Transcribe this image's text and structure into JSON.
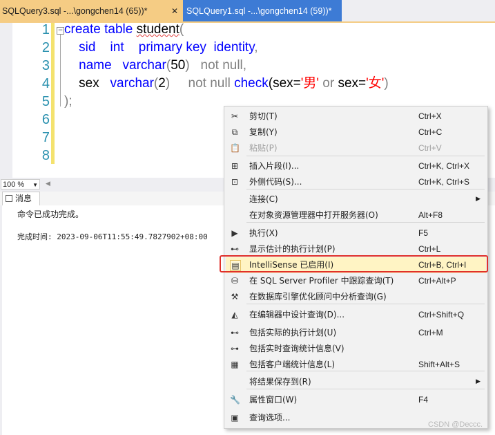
{
  "tabs": [
    {
      "label": "SQLQuery3.sql -...\\gongchen14 (65))*",
      "close": "✕"
    },
    {
      "label": "SQLQuery1.sql -...\\gongchen14 (59))*"
    }
  ],
  "editor": {
    "line_numbers": [
      "1",
      "2",
      "3",
      "4",
      "5",
      "6",
      "7",
      "8"
    ],
    "code": {
      "l1": {
        "create": "create",
        "table": "table",
        "name": "student",
        "paren": "("
      },
      "l2": {
        "col": "sid",
        "type": "int",
        "pk": "primary key",
        "identity": "identity",
        "comma": ","
      },
      "l3": {
        "col": "name",
        "type": "varchar",
        "open": "(",
        "len": "50",
        "close": ")",
        "notnull": "not null",
        "comma": ","
      },
      "l4": {
        "col": "sex",
        "type": "varchar",
        "open": "(",
        "len": "2",
        "close": ")",
        "notnull": "not null",
        "check": "check",
        "expr_open": "(sex=",
        "v1": "'男'",
        "or": " or ",
        "sex2": "sex=",
        "v2": "'女'",
        "expr_close": ")"
      },
      "l5": {
        "text": ");"
      }
    }
  },
  "zoom": {
    "value": "100 %"
  },
  "messages": {
    "tab_label": "消息",
    "line1": "命令已成功完成。",
    "line2": "完成时间: 2023-09-06T11:55:49.7827902+08:00"
  },
  "context_menu": {
    "items": [
      {
        "icon": "cut-icon",
        "glyph": "✂",
        "label": "剪切(T)",
        "shortcut": "Ctrl+X"
      },
      {
        "icon": "copy-icon",
        "glyph": "⧉",
        "label": "复制(Y)",
        "shortcut": "Ctrl+C"
      },
      {
        "icon": "paste-icon",
        "glyph": "📋",
        "label": "粘贴(P)",
        "shortcut": "Ctrl+V",
        "disabled": true
      },
      {
        "icon": "insert-snippet-icon",
        "glyph": "⊞",
        "label": "插入片段(I)...",
        "shortcut": "Ctrl+K, Ctrl+X"
      },
      {
        "icon": "surround-with-icon",
        "glyph": "⊡",
        "label": "外侧代码(S)...",
        "shortcut": "Ctrl+K, Ctrl+S"
      },
      {
        "icon": "",
        "glyph": "",
        "label": "连接(C)",
        "shortcut": "",
        "submenu": true
      },
      {
        "icon": "",
        "glyph": "",
        "label": "在对象资源管理器中打开服务器(O)",
        "shortcut": "Alt+F8"
      },
      {
        "icon": "execute-icon",
        "glyph": "▶",
        "label": "执行(X)",
        "shortcut": "F5"
      },
      {
        "icon": "estimated-plan-icon",
        "glyph": "⊷",
        "label": "显示估计的执行计划(P)",
        "shortcut": "Ctrl+L"
      },
      {
        "icon": "intellisense-icon",
        "glyph": "▤",
        "label": "IntelliSense 已启用(I)",
        "shortcut": "Ctrl+B, Ctrl+I",
        "checked": true
      },
      {
        "icon": "profiler-icon",
        "glyph": "⛁",
        "label": "在 SQL Server Profiler 中跟踪查询(T)",
        "shortcut": "Ctrl+Alt+P"
      },
      {
        "icon": "tuning-advisor-icon",
        "glyph": "⚒",
        "label": "在数据库引擎优化顾问中分析查询(G)",
        "shortcut": ""
      },
      {
        "icon": "query-designer-icon",
        "glyph": "◭",
        "label": "在编辑器中设计查询(D)...",
        "shortcut": "Ctrl+Shift+Q"
      },
      {
        "icon": "actual-plan-icon",
        "glyph": "⊷",
        "label": "包括实际的执行计划(U)",
        "shortcut": "Ctrl+M"
      },
      {
        "icon": "live-stats-icon",
        "glyph": "⊶",
        "label": "包括实时查询统计信息(V)",
        "shortcut": ""
      },
      {
        "icon": "client-stats-icon",
        "glyph": "▦",
        "label": "包括客户端统计信息(L)",
        "shortcut": "Shift+Alt+S"
      },
      {
        "icon": "",
        "glyph": "",
        "label": "将结果保存到(R)",
        "shortcut": "",
        "submenu": true
      },
      {
        "icon": "properties-icon",
        "glyph": "🔧",
        "label": "属性窗口(W)",
        "shortcut": "F4"
      },
      {
        "icon": "query-options-icon",
        "glyph": "▣",
        "label": "查询选项...",
        "shortcut": ""
      }
    ],
    "submenu_arrow": "▶"
  },
  "watermark": "CSDN @Deccc."
}
